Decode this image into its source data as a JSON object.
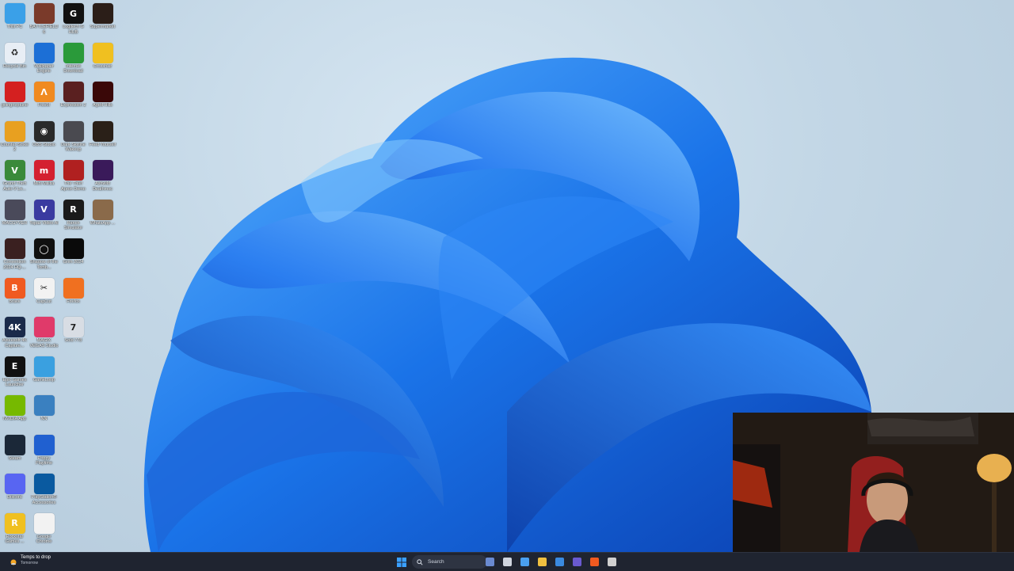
{
  "desktop": {
    "icons": [
      {
        "label": "This PC",
        "color": "#3aa0e8",
        "glyph": ""
      },
      {
        "label": "BATTLEFIELD 6",
        "color": "#7a3a2a",
        "glyph": ""
      },
      {
        "label": "Logitech G HUB",
        "color": "#111111",
        "glyph": "G"
      },
      {
        "label": "Supermarket",
        "color": "#2b1e18",
        "glyph": ""
      },
      {
        "label": "Recycle Bin",
        "color": "#e8eef5",
        "glyph": "♻"
      },
      {
        "label": "Wallpaper Engine",
        "color": "#1c6fd6",
        "glyph": ""
      },
      {
        "label": "Internet Download",
        "color": "#2a9a3a",
        "glyph": ""
      },
      {
        "label": "Crosshair",
        "color": "#f0c020",
        "glyph": ""
      },
      {
        "label": "goingneptune",
        "color": "#d42020",
        "glyph": ""
      },
      {
        "label": "FiveM",
        "color": "#f08a20",
        "glyph": "Λ"
      },
      {
        "label": "Expression 2",
        "color": "#5a2020",
        "glyph": ""
      },
      {
        "label": "Aged Hills",
        "color": "#3a0808",
        "glyph": ""
      },
      {
        "label": "Counter-Strike 2",
        "color": "#e8a020",
        "glyph": ""
      },
      {
        "label": "OBS Studio",
        "color": "#2a2a2a",
        "glyph": "◉"
      },
      {
        "label": "Dark Skyline Wakeup",
        "color": "#4a4a50",
        "glyph": ""
      },
      {
        "label": "Feed Yourself",
        "color": "#2a2018",
        "glyph": ""
      },
      {
        "label": "Grand Theft Auto V Le...",
        "color": "#3a8a3a",
        "glyph": "V"
      },
      {
        "label": "Mini Militia",
        "color": "#d42030",
        "glyph": "m"
      },
      {
        "label": "The Thief Apron Demo",
        "color": "#b02020",
        "glyph": ""
      },
      {
        "label": "Ashwild Deathmoc",
        "color": "#3a1a5a",
        "glyph": ""
      },
      {
        "label": "MACGYVER",
        "color": "#4a4a5a",
        "glyph": ""
      },
      {
        "label": "Topaz Video AI",
        "color": "#3a3aa0",
        "glyph": "V"
      },
      {
        "label": "Ranch Simulator",
        "color": "#1a1a1a",
        "glyph": "R"
      },
      {
        "label": "WhatsApp ...",
        "color": "#8a6a4a",
        "glyph": ""
      },
      {
        "label": "Convention 2024 HQ-...",
        "color": "#3a2020",
        "glyph": ""
      },
      {
        "label": "Shadow of the Tomb...",
        "color": "#101010",
        "glyph": "◯"
      },
      {
        "label": "Grim 2024",
        "color": "#0a0a0a",
        "glyph": ""
      },
      {
        "label": "Brave",
        "color": "#f05a20",
        "glyph": "B"
      },
      {
        "label": "CapCut",
        "color": "#f2f2f2",
        "glyph": "✂"
      },
      {
        "label": "Firefox",
        "color": "#f07020",
        "glyph": ""
      },
      {
        "label": "Aiseesoft 4K Capture...",
        "color": "#1a2a4a",
        "glyph": "4K"
      },
      {
        "label": "MAGIX VEGAS Studio",
        "color": "#e03a6a",
        "glyph": ""
      },
      {
        "label": "Sold 778",
        "color": "#d8dde4",
        "glyph": "7"
      },
      {
        "label": "Epic Games Launcher",
        "color": "#111111",
        "glyph": "E"
      },
      {
        "label": "GameLoop",
        "color": "#3aa0e0",
        "glyph": ""
      },
      {
        "label": "NVIDIA App",
        "color": "#76b900",
        "glyph": ""
      },
      {
        "label": "NN",
        "color": "#3a80c0",
        "glyph": ""
      },
      {
        "label": "Steam",
        "color": "#1b2838",
        "glyph": ""
      },
      {
        "label": "Poppy Playtime",
        "color": "#2060d0",
        "glyph": ""
      },
      {
        "label": "Discord",
        "color": "#5865f2",
        "glyph": ""
      },
      {
        "label": "PlayStation® Accessories",
        "color": "#0a5aa0",
        "glyph": ""
      },
      {
        "label": "Rockstar Games ...",
        "color": "#f0c020",
        "glyph": "R"
      },
      {
        "label": "Google Chrome",
        "color": "#f2f2f2",
        "glyph": ""
      }
    ]
  },
  "webcam": {
    "name": "webcam-overlay"
  },
  "taskbar": {
    "weather": {
      "title": "Temps to drop",
      "subtitle": "Tomorrow"
    },
    "search_label": "Search",
    "apps": [
      {
        "name": "widgets",
        "color": "#6a8ad0"
      },
      {
        "name": "task-view",
        "color": "#cfd5df"
      },
      {
        "name": "copilot",
        "color": "#4aa0f0"
      },
      {
        "name": "file-explorer",
        "color": "#f0c040"
      },
      {
        "name": "microsoft-store",
        "color": "#3a8ae0"
      },
      {
        "name": "teams",
        "color": "#6a5ad0"
      },
      {
        "name": "brave",
        "color": "#f05a20"
      },
      {
        "name": "chrome",
        "color": "#d0d0d0"
      }
    ]
  }
}
